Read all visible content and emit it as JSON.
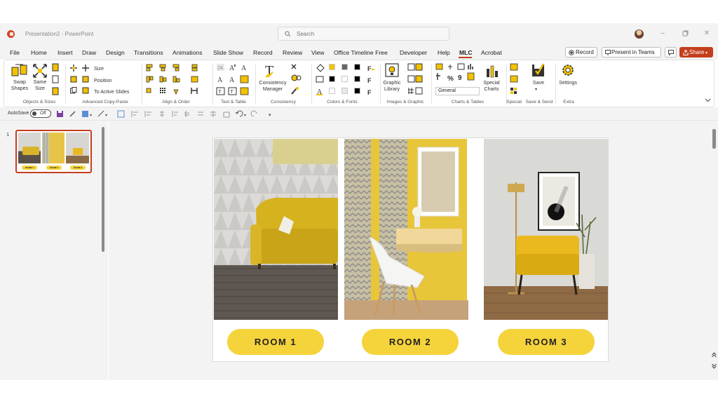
{
  "app": {
    "document_title": "Presentation2 - PowerPoint"
  },
  "search": {
    "placeholder": "Search"
  },
  "menu": {
    "tabs": [
      "File",
      "Home",
      "Insert",
      "Draw",
      "Design",
      "Transitions",
      "Animations",
      "Slide Show",
      "Record",
      "Review",
      "View",
      "Office Timeline Free",
      "Developer",
      "Help",
      "MLC",
      "Acrobat"
    ],
    "active_tab": "MLC",
    "record_label": "Record",
    "present_label": "Present in Teams",
    "share_label": "Share"
  },
  "ribbon": {
    "swap_shapes": "Swap\nShapes",
    "same_size": "Same\nSize",
    "size": "Size",
    "position": "Position",
    "to_active_slides": "To Active Slides",
    "consistency_manager": "Consistency\nManager",
    "graphic_library": "Graphic\nLibrary",
    "number_format": "General",
    "special_charts": "Special\nCharts",
    "save": "Save",
    "settings": "Settings",
    "groups": {
      "objects_sizes": "Objects & Sizes",
      "advanced_copy_paste": "Advanced Copy-Paste",
      "align_order": "Align & Order",
      "text_table": "Text & Table",
      "consistency": "Consistency",
      "colors_fonts": "Colors & Fonts",
      "images_graphic": "Images & Graphic",
      "charts_tables": "Charts & Tables",
      "special": "Special",
      "save_send": "Save & Send",
      "extra": "Extra"
    }
  },
  "qat": {
    "autosave_label": "AutoSave",
    "autosave_state": "Off"
  },
  "slides": {
    "current_number": "1"
  },
  "slide": {
    "rooms": [
      "ROOM 1",
      "ROOM 2",
      "ROOM 3"
    ]
  },
  "colors": {
    "accent": "#c43e1c",
    "pill": "#f5d33a",
    "ribbon_icon_yellow": "#f2c200"
  }
}
